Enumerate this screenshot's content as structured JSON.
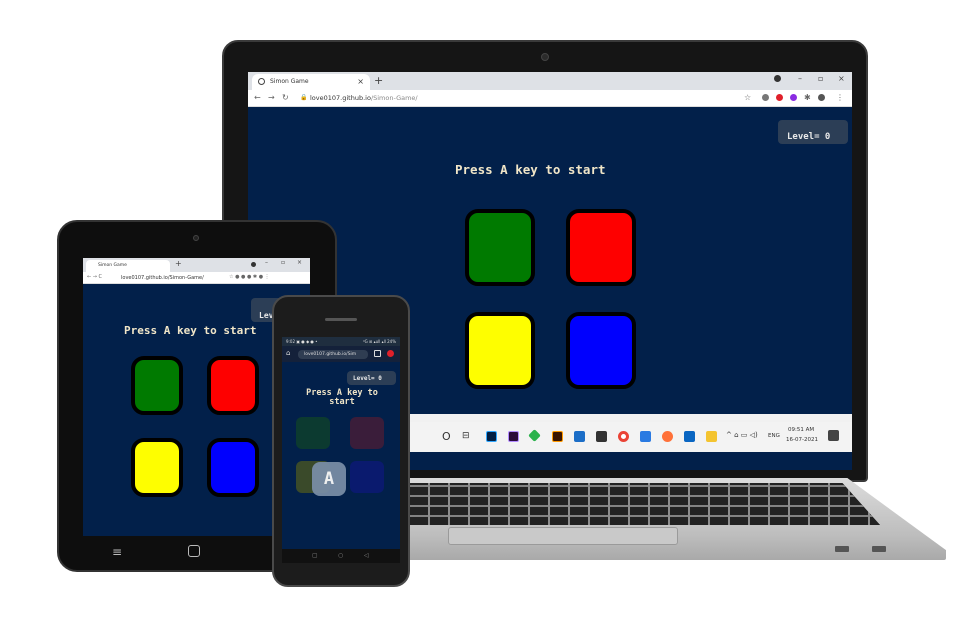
{
  "browser": {
    "tab_title": "Simon Game",
    "tab_close": "×",
    "new_tab": "+",
    "url_host": "love0107.github.io",
    "url_path": "/Simon-Game/",
    "url_full": "love0107.github.io/Simon-Game/",
    "window_controls": [
      "–",
      "▫",
      "×"
    ]
  },
  "game": {
    "title": "Press A key to start",
    "level_label": "Level= 0",
    "level_label_clipped_tablet": "Lev",
    "pads": [
      {
        "name": "green",
        "color": "#007a00"
      },
      {
        "name": "red",
        "color": "#fe0000"
      },
      {
        "name": "yellow",
        "color": "#fefe00"
      },
      {
        "name": "blue",
        "color": "#0000fe"
      }
    ],
    "background_color": "#02204a",
    "title_color": "#f1e6c8"
  },
  "phone": {
    "title_line1": "Press A key to",
    "title_line2": "start",
    "url": "love0107.github.io/Sim",
    "status": "9:02 ▣ ● ◆ ● •",
    "status_right": "⁴G ⊞ ▴ull ▴ll 24%",
    "key_overlay": "A"
  },
  "taskbar": {
    "time": "09:51 AM",
    "date": "16-07-2021",
    "lang": "ENG",
    "search_circle": "O",
    "task_view": "⊟"
  }
}
